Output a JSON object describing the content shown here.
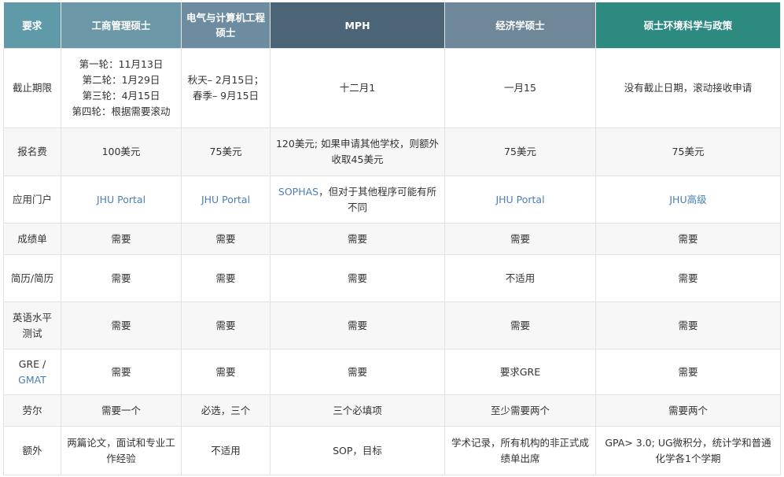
{
  "headers": {
    "requirement": "要求",
    "mba": "工商管理硕士",
    "ece": "电气与计算机工程硕士",
    "mph": "MPH",
    "econ": "经济学硕士",
    "env": "硕士环境科学与政策"
  },
  "rows": {
    "deadline": {
      "label": "截止期限",
      "mba": [
        "第一轮：11月13日",
        "第二轮：1月29日",
        "第三轮：4月15日",
        "第四轮：根据需要滚动"
      ],
      "ece": [
        "秋天– 2月15日；",
        "春季– 9月15日"
      ],
      "mph": "十二月1",
      "econ": "一月15",
      "env": "没有截止日期，滚动接收申请"
    },
    "fee": {
      "label": "报名费",
      "mba": "100美元",
      "ece": "75美元",
      "mph": "120美元; 如果申请其他学校，则额外收取45美元",
      "econ": "75美元",
      "env": "75美元"
    },
    "portal": {
      "label": "应用门户",
      "mba": "JHU Portal",
      "ece": "JHU Portal",
      "mph_link": "SOPHAS",
      "mph_rest": "，但对于其他程序可能有所不同",
      "econ": "JHU Portal",
      "env": "JHU高级"
    },
    "transcript": {
      "label": "成绩单",
      "mba": "需要",
      "ece": "需要",
      "mph": "需要",
      "econ": "需要",
      "env": "需要"
    },
    "resume": {
      "label": "简历/简历",
      "mba": "需要",
      "ece": "需要",
      "mph": "需要",
      "econ": "不适用",
      "env": "需要"
    },
    "english": {
      "label": "英语水平测试",
      "mba": "需要",
      "ece": "需要",
      "mph": "需要",
      "econ": "需要",
      "env": "需要"
    },
    "gre": {
      "label_a": "GRE /",
      "label_b": "GMAT",
      "mba": "需要",
      "ece": "需要",
      "mph": "需要",
      "econ": "要求GRE",
      "env": "需要"
    },
    "lor": {
      "label": "劳尔",
      "mba": "需要一个",
      "ece": "必选，三个",
      "mph": "三个必填项",
      "econ": "至少需要两个",
      "env": "需要两个"
    },
    "extra": {
      "label": "额外",
      "mba": "两篇论文，面试和专业工作经验",
      "ece": "不适用",
      "mph": "SOP，目标",
      "econ": "学术记录，所有机构的非正式成绩单出席",
      "env": "GPA> 3.0; UG微积分，统计学和普通化学各1个学期"
    }
  },
  "colors": {
    "link": "#4a7fb5",
    "header_teal": "#2d8a80",
    "header_dark": "#4b6576"
  }
}
